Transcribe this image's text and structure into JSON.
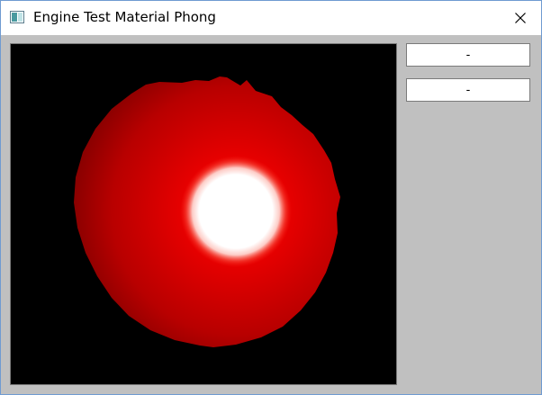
{
  "window": {
    "title": "Engine Test Material Phong"
  },
  "side_panel": {
    "buttons": [
      {
        "label": "-"
      },
      {
        "label": "-"
      }
    ]
  },
  "viewport": {
    "background_color": "#000000",
    "object": "sphere",
    "material": "phong",
    "diffuse_color": "#e00000",
    "specular_color": "#ffffff"
  },
  "colors": {
    "titlebar": "#ffffff",
    "client_background": "#c0c0c0",
    "window_border": "#6f9bd1"
  }
}
